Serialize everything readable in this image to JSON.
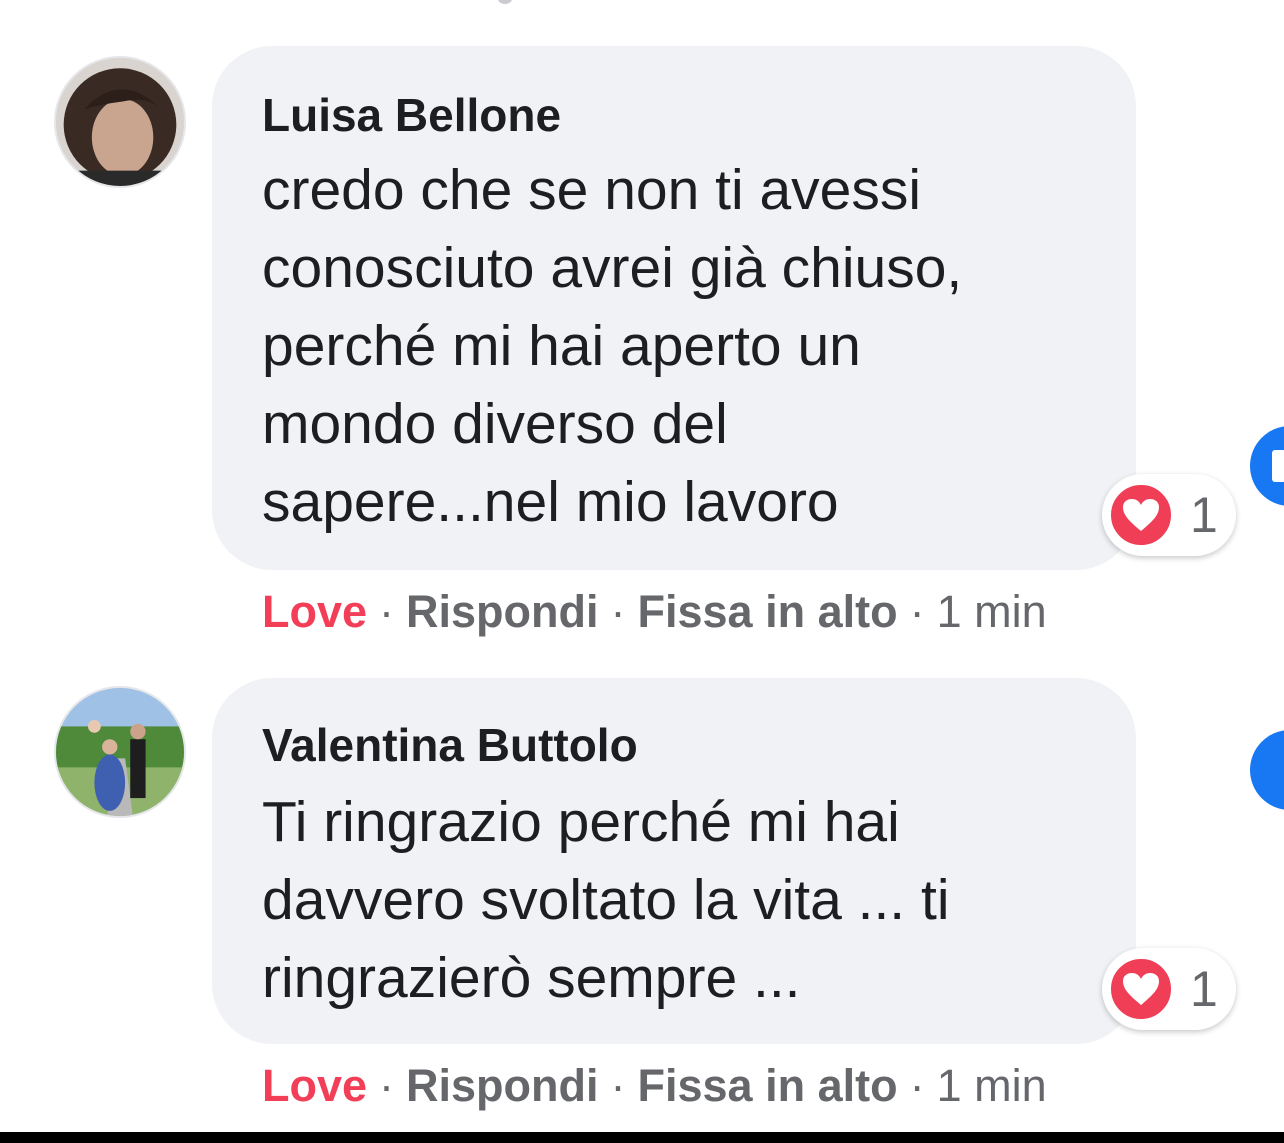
{
  "comments": [
    {
      "author": "Luisa Bellone",
      "text_lines": [
        "credo che se non ti avessi",
        "conosciuto avrei già chiuso,",
        "perché mi hai aperto un",
        "mondo diverso del",
        "sapere...nel mio lavoro"
      ],
      "reaction": {
        "icon": "heart-icon",
        "count": "1"
      },
      "actions": {
        "love": "Love",
        "reply": "Rispondi",
        "pin": "Fissa in alto",
        "time": "1 min",
        "separator": "·"
      }
    },
    {
      "author": "Valentina Buttolo",
      "text_lines": [
        "Ti ringrazio perché mi hai",
        "davvero svoltato la vita ... ti",
        "ringrazierò sempre ..."
      ],
      "reaction": {
        "icon": "heart-icon",
        "count": "1"
      },
      "actions": {
        "love": "Love",
        "reply": "Rispondi",
        "pin": "Fissa in alto",
        "time": "1 min",
        "separator": "·"
      }
    }
  ],
  "colors": {
    "bubble": "#f0f2f5",
    "love": "#f33e58",
    "secondary_text": "#65676b",
    "primary_text": "#1c1e21",
    "heart": "#ef3e55",
    "edge_button": "#1877f2"
  }
}
